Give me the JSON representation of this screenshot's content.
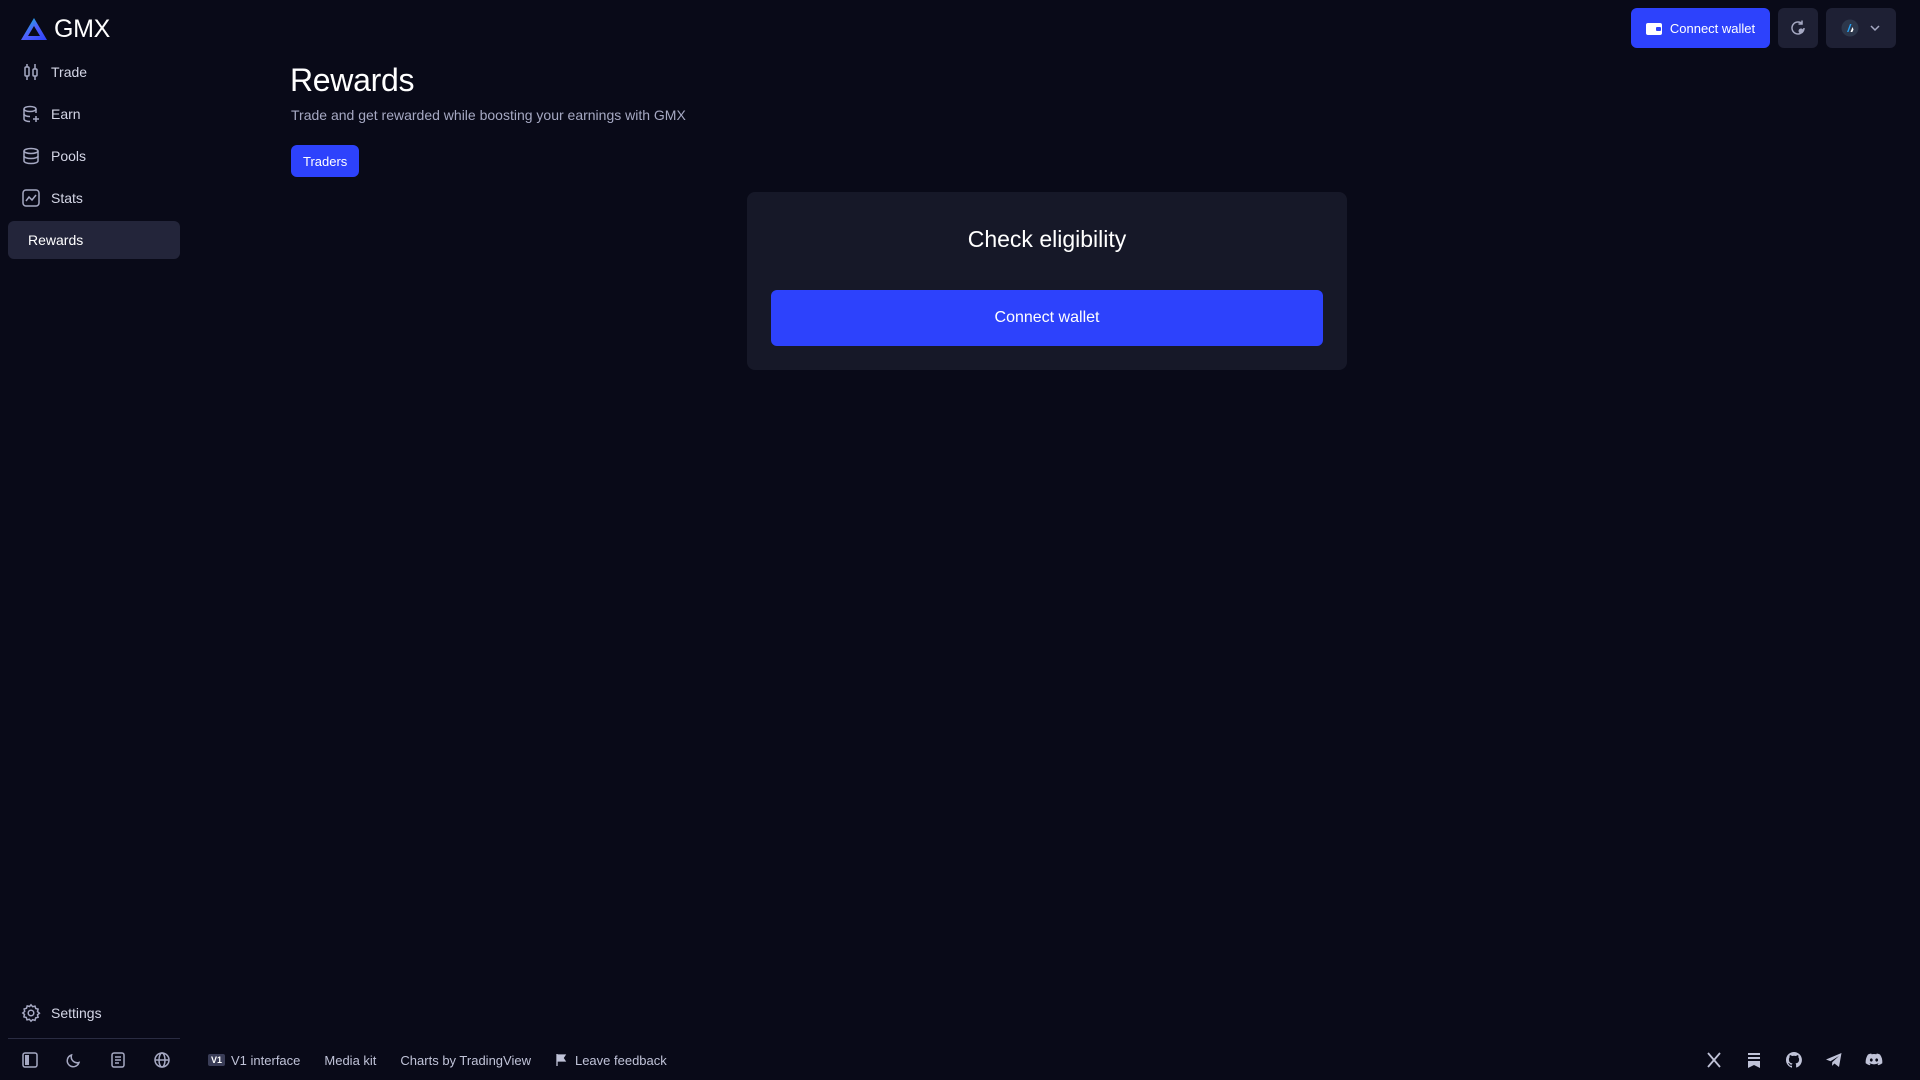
{
  "brand": {
    "name": "GMX",
    "accent": "#2d42fc"
  },
  "sidebar": {
    "items": [
      {
        "label": "Trade",
        "icon": "candlestick-icon"
      },
      {
        "label": "Earn",
        "icon": "coins-icon"
      },
      {
        "label": "Pools",
        "icon": "database-icon"
      },
      {
        "label": "Stats",
        "icon": "chart-icon"
      },
      {
        "label": "Rewards",
        "active": true
      }
    ],
    "settings_label": "Settings",
    "tools": [
      "collapse-sidebar-icon",
      "theme-moon-icon",
      "docs-icon",
      "language-globe-icon"
    ]
  },
  "header": {
    "connect_label": "Connect wallet",
    "network_icon": "arbitrum-icon"
  },
  "main": {
    "title": "Rewards",
    "subtitle": "Trade and get rewarded while boosting your earnings with GMX",
    "tabs": [
      {
        "label": "Traders",
        "active": true
      }
    ],
    "card": {
      "title": "Check eligibility",
      "button_label": "Connect wallet"
    }
  },
  "footer": {
    "links": [
      {
        "badge": "V1",
        "label": "V1 interface"
      },
      {
        "label": "Media kit"
      },
      {
        "label": "Charts by TradingView"
      },
      {
        "label": "Leave feedback",
        "icon": "feedback-flag-icon"
      }
    ],
    "socials": [
      "x-twitter-icon",
      "substack-icon",
      "github-icon",
      "telegram-icon",
      "discord-icon"
    ]
  }
}
